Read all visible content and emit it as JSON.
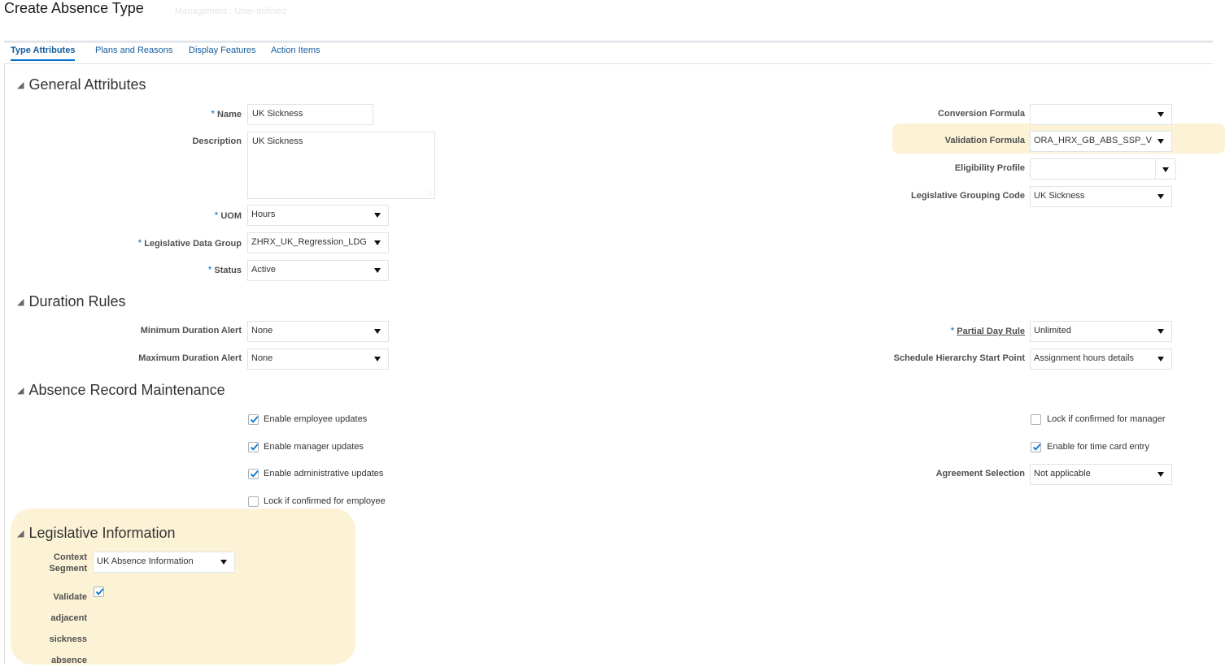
{
  "header": {
    "title": "Create Absence Type",
    "subtitle": "Management : User-defined"
  },
  "tabs": [
    {
      "label": "Type Attributes",
      "active": true
    },
    {
      "label": "Plans and Reasons",
      "active": false
    },
    {
      "label": "Display Features",
      "active": false
    },
    {
      "label": "Action Items",
      "active": false
    }
  ],
  "sections": {
    "general": "General Attributes",
    "duration": "Duration Rules",
    "maintenance": "Absence Record Maintenance",
    "legislative": "Legislative Information"
  },
  "required_marker": "*",
  "general": {
    "name": {
      "label": "Name",
      "value": "UK Sickness"
    },
    "description": {
      "label": "Description",
      "value": "UK Sickness"
    },
    "uom": {
      "label": "UOM",
      "value": "Hours"
    },
    "ldg": {
      "label": "Legislative Data Group",
      "value": "ZHRX_UK_Regression_LDG"
    },
    "status": {
      "label": "Status",
      "value": "Active"
    },
    "conversion_formula": {
      "label": "Conversion Formula",
      "value": ""
    },
    "validation_formula": {
      "label": "Validation Formula",
      "value": "ORA_HRX_GB_ABS_SSP_V"
    },
    "eligibility_profile": {
      "label": "Eligibility Profile",
      "value": ""
    },
    "legislative_grouping": {
      "label": "Legislative Grouping Code",
      "value": "UK Sickness"
    }
  },
  "duration": {
    "min_alert": {
      "label": "Minimum Duration Alert",
      "value": "None"
    },
    "max_alert": {
      "label": "Maximum Duration Alert",
      "value": "None"
    },
    "partial_day": {
      "label": "Partial Day Rule",
      "value": "Unlimited"
    },
    "schedule_start": {
      "label": "Schedule Hierarchy Start Point",
      "value": "Assignment hours details"
    }
  },
  "maintenance": {
    "enable_employee": {
      "label": "Enable employee updates",
      "checked": true
    },
    "enable_manager": {
      "label": "Enable manager updates",
      "checked": true
    },
    "enable_admin": {
      "label": "Enable administrative updates",
      "checked": true
    },
    "lock_employee": {
      "label": "Lock if confirmed for employee",
      "checked": false
    },
    "lock_manager": {
      "label": "Lock if confirmed for manager",
      "checked": false
    },
    "time_card": {
      "label": "Enable for time card entry",
      "checked": true
    },
    "agreement": {
      "label": "Agreement Selection",
      "value": "Not applicable"
    }
  },
  "legislative": {
    "context_segment": {
      "label_line1": "Context",
      "label_line2": "Segment",
      "value": "UK Absence Information"
    },
    "validate": {
      "label_lines": [
        "Validate",
        "adjacent",
        "sickness",
        "absence"
      ],
      "checked": true
    }
  },
  "colors": {
    "highlight": "#fcf3d6",
    "tab_link": "#145c9e",
    "required": "#0572ce",
    "check": "#0572ce"
  }
}
